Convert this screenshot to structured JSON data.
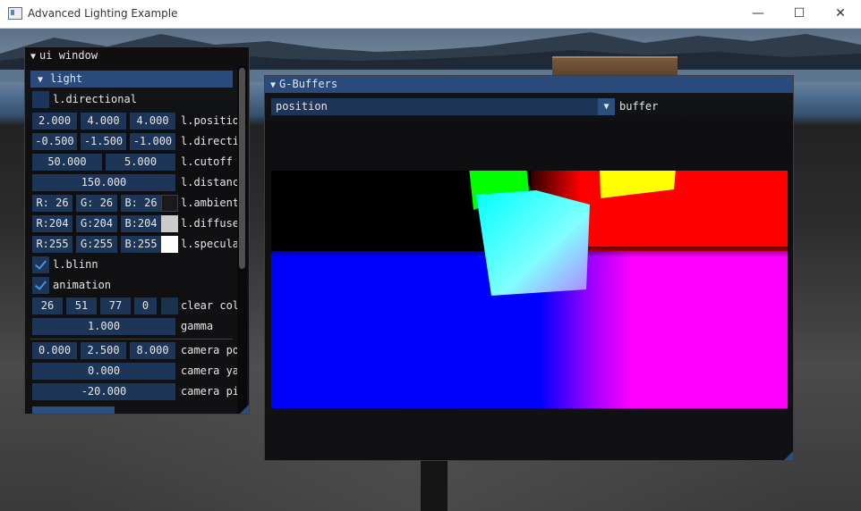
{
  "window": {
    "title": "Advanced Lighting Example",
    "minimize_glyph": "—",
    "maximize_glyph": "☐",
    "close_glyph": "✕"
  },
  "ui_window": {
    "title": "ui window",
    "section": "light",
    "directional_label": "l.directional",
    "directional_checked": false,
    "position": {
      "x": "2.000",
      "y": "4.000",
      "z": "4.000",
      "label": "l.positio"
    },
    "direction": {
      "x": "-0.500",
      "y": "-1.500",
      "z": "-1.000",
      "label": "l.directi"
    },
    "cutoff": {
      "a": "50.000",
      "b": "5.000",
      "label": "l.cutoff"
    },
    "distance": {
      "value": "150.000",
      "label": "l.distanc"
    },
    "ambient": {
      "r": "R: 26",
      "g": "G: 26",
      "b": "B: 26",
      "label": "l.ambient",
      "color": "#1a1a1a"
    },
    "diffuse": {
      "r": "R:204",
      "g": "G:204",
      "b": "B:204",
      "label": "l.diffuse",
      "color": "#cccccc"
    },
    "specular": {
      "r": "R:255",
      "g": "G:255",
      "b": "B:255",
      "label": "l.specula",
      "color": "#ffffff"
    },
    "blinn": {
      "label": "l.blinn",
      "checked": true
    },
    "animation": {
      "label": "animation",
      "checked": true
    },
    "clear_color": {
      "r": "26",
      "g": "51",
      "b": "77",
      "a": "0",
      "label": "clear col",
      "color": "#1a334d"
    },
    "gamma": {
      "value": "1.000",
      "label": "gamma"
    },
    "camera_pos": {
      "x": "0.000",
      "y": "2.500",
      "z": "8.000",
      "label": "camera po"
    },
    "camera_yaw": {
      "value": "0.000",
      "label": "camera ya"
    },
    "camera_pitch": {
      "value": "-20.000",
      "label": "camera pi"
    }
  },
  "gbuffers": {
    "title": "G-Buffers",
    "selected": "position",
    "combo_label": "buffer"
  },
  "colors": {
    "accent": "#294a7a",
    "frame": "#1d3556",
    "check": "#4a90e2"
  }
}
